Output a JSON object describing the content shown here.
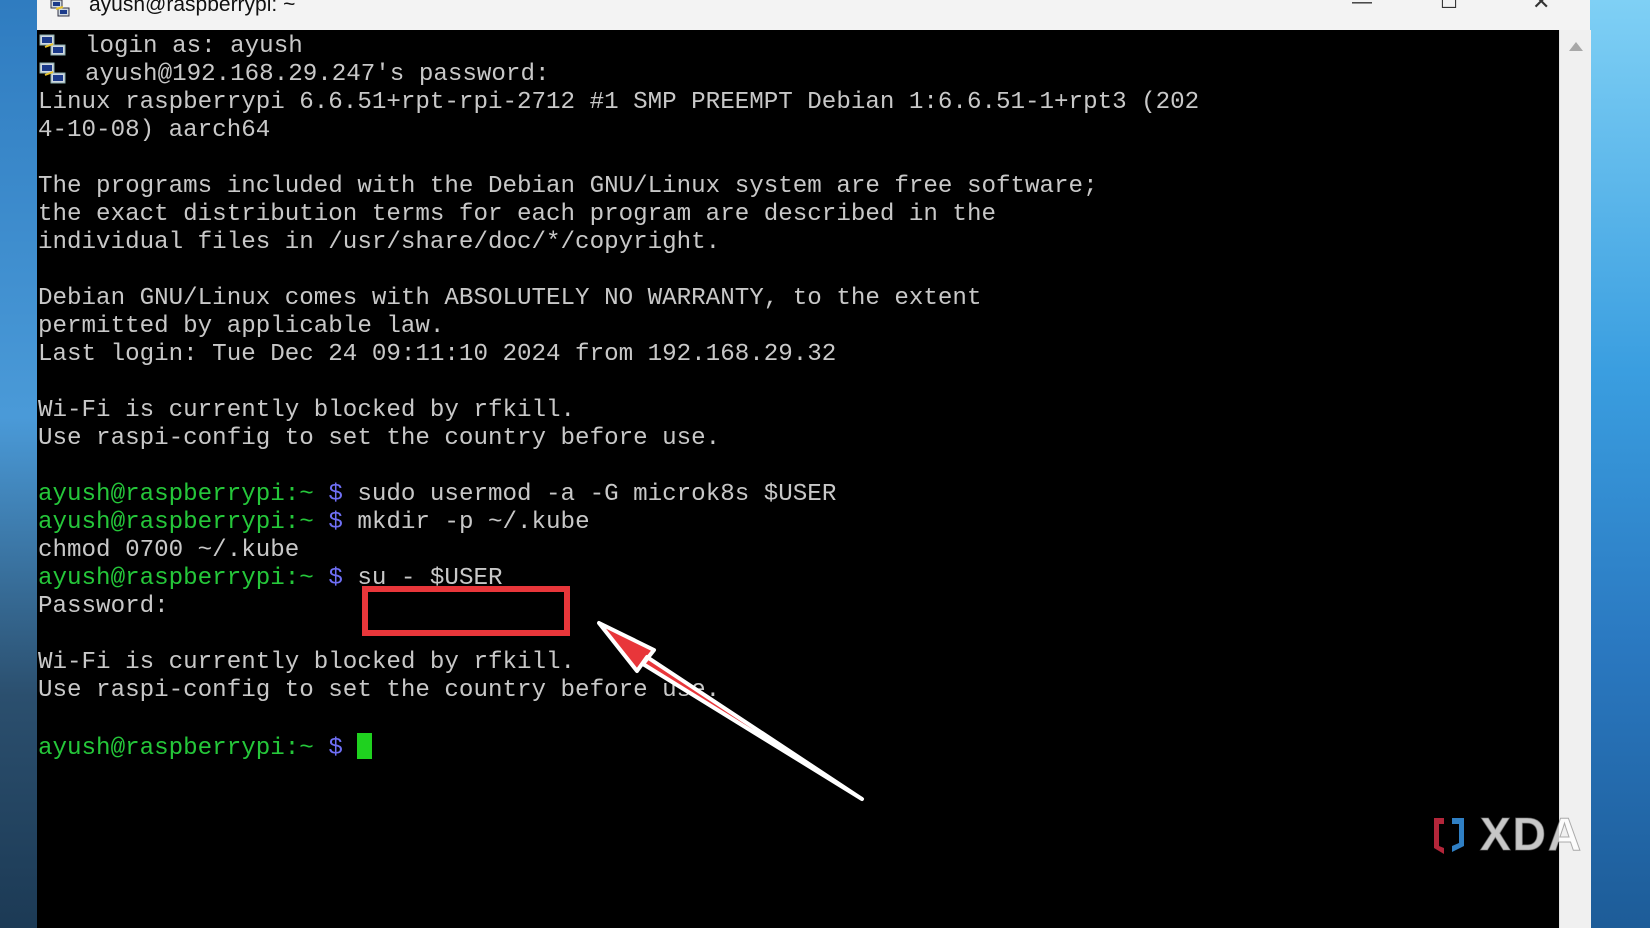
{
  "window": {
    "title": "ayush@raspberrypi: ~",
    "app_icon": "putty-icon",
    "controls": {
      "minimize": "—",
      "maximize": "☐",
      "close": "✕"
    }
  },
  "terminal": {
    "lines": [
      "login as: ayush",
      "ayush@192.168.29.247's password:",
      "Linux raspberrypi 6.6.51+rpt-rpi-2712 #1 SMP PREEMPT Debian 1:6.6.51-1+rpt3 (202",
      "4-10-08) aarch64",
      "The programs included with the Debian GNU/Linux system are free software;",
      "the exact distribution terms for each program are described in the",
      "individual files in /usr/share/doc/*/copyright.",
      "Debian GNU/Linux comes with ABSOLUTELY NO WARRANTY, to the extent",
      "permitted by applicable law.",
      "Last login: Tue Dec 24 09:11:10 2024 from 192.168.29.32",
      "Wi-Fi is currently blocked by rfkill.",
      "Use raspi-config to set the country before use.",
      "chmod 0700 ~/.kube",
      "Password:",
      "Wi-Fi is currently blocked by rfkill.",
      "Use raspi-config to set the country before use."
    ],
    "prompt_user": "ayush@raspberrypi:~",
    "prompt_sign": "$",
    "commands": [
      "sudo usermod -a -G microk8s $USER",
      "mkdir -p ~/.kube",
      "su - $USER"
    ],
    "cursor_color": "#1fd11f"
  },
  "annotation": {
    "highlight_color": "#e8363a",
    "arrow_color": "#e8363a"
  },
  "watermark": {
    "text": "XDA"
  },
  "colors": {
    "terminal_bg": "#000000",
    "terminal_fg": "#c8c8c8",
    "prompt_green": "#25c73a",
    "prompt_blue": "#6f6ff5"
  }
}
